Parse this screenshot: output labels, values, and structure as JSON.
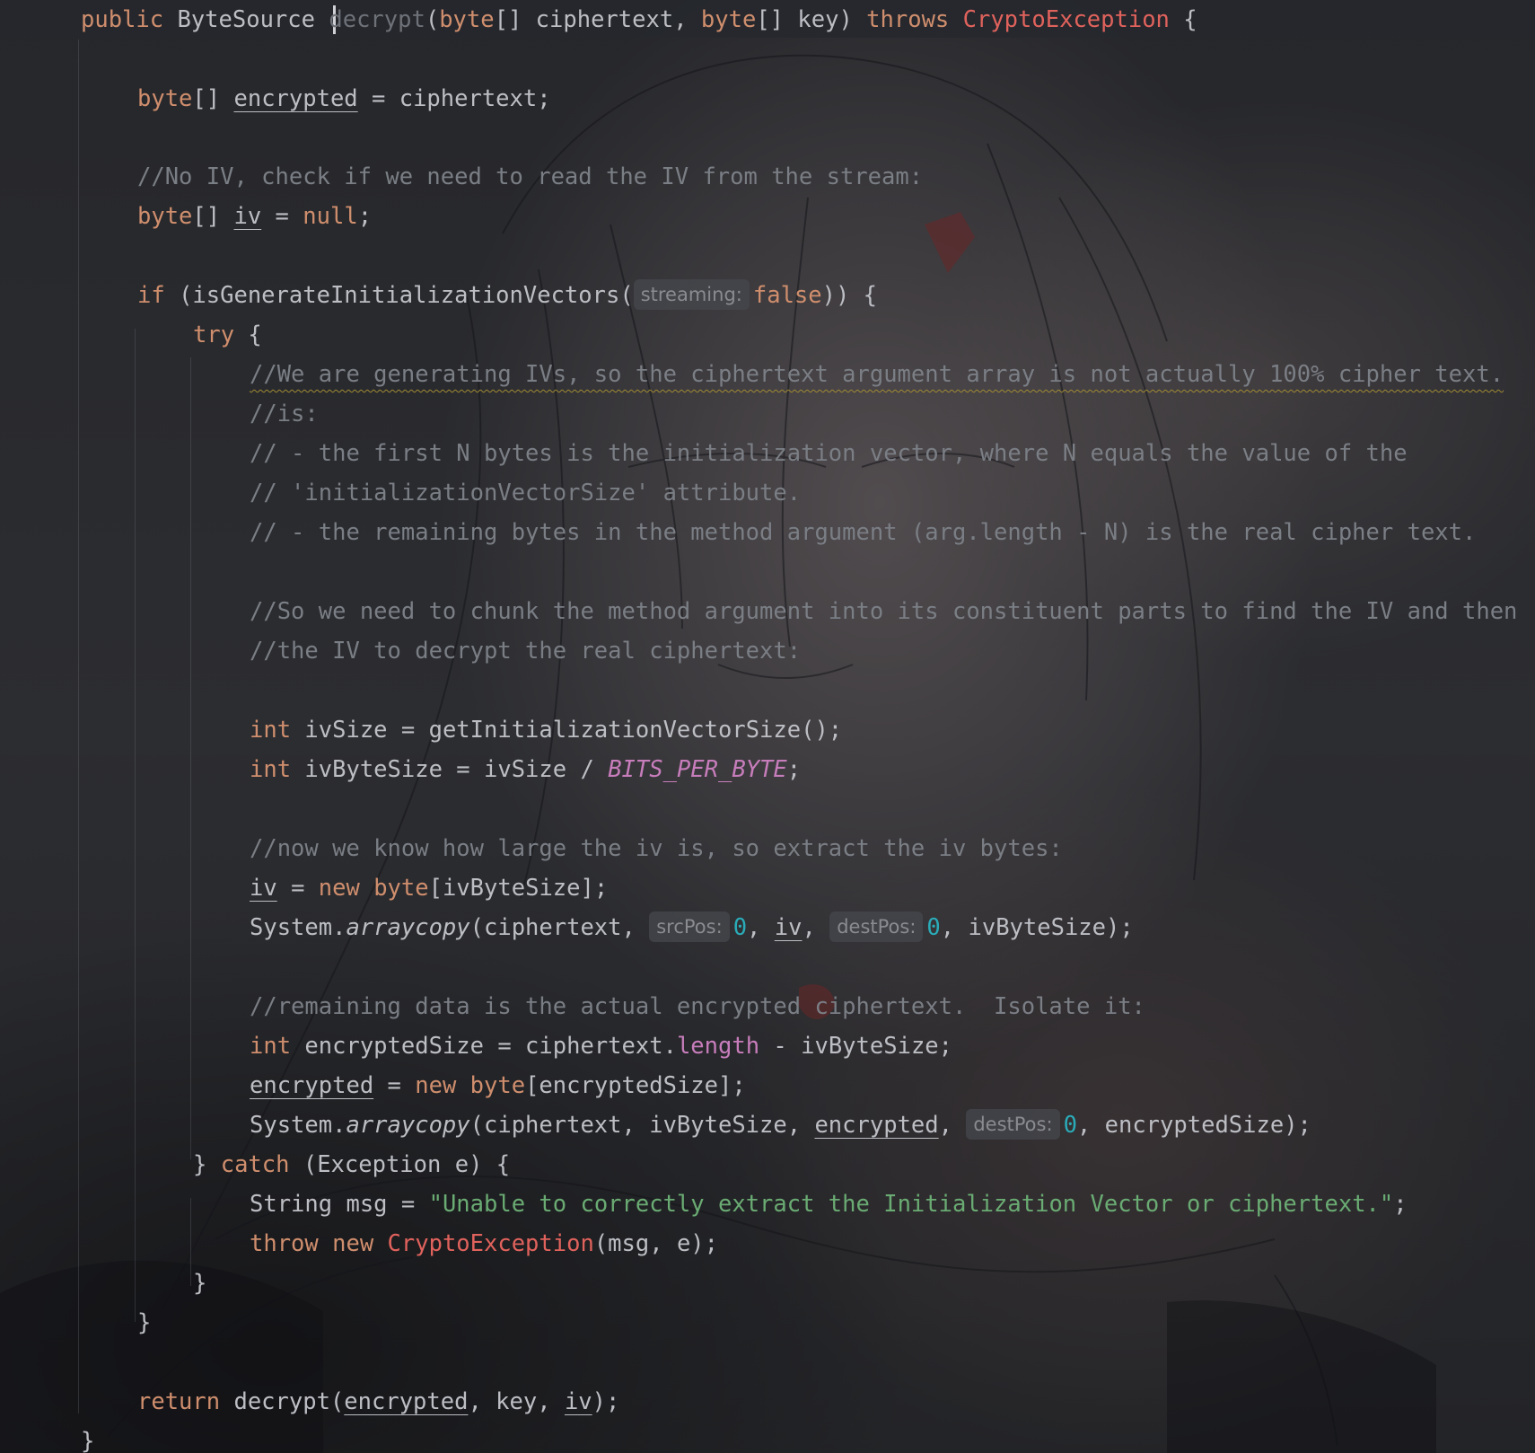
{
  "l1": {
    "a": "public ",
    "b": "ByteSource ",
    "c": "decrypt",
    "d": "(",
    "e": "byte",
    "f": "[] ciphertext, ",
    "g": "byte",
    "h": "[] key) ",
    "i": "throws ",
    "j": "CryptoException",
    "k": " {"
  },
  "l2": {
    "a": "byte",
    "b": "[] ",
    "c": "encrypted",
    "d": " = ciphertext;"
  },
  "l3": {
    "a": "//No IV, check if we need to read the IV from the stream:"
  },
  "l4": {
    "a": "byte",
    "b": "[] ",
    "c": "iv",
    "d": " = ",
    "e": "null",
    "f": ";"
  },
  "l5": {
    "a": "if ",
    "b": "(isGenerateInitializationVectors(",
    "hint": "streaming:",
    "c": "false",
    "d": ")) {"
  },
  "l6": {
    "a": "try",
    "b": " {"
  },
  "l7": {
    "a": "//We are generating IVs, so the ciphertext argument array is not actually 100% cipher text."
  },
  "l8": {
    "a": "//is:"
  },
  "l9": {
    "a": "// - the first N bytes is the initialization vector, where N equals the value of the"
  },
  "l10": {
    "a": "// 'initializationVectorSize' attribute."
  },
  "l11": {
    "a": "// - the remaining bytes in the method argument (arg.length - N) is the real cipher text."
  },
  "l12": {
    "a": "//So we need to chunk the method argument into its constituent parts to find the IV and then"
  },
  "l13": {
    "a": "//the IV to decrypt the real ciphertext:"
  },
  "l14": {
    "a": "int ",
    "b": "ivSize = getInitializationVectorSize();"
  },
  "l15": {
    "a": "int ",
    "b": "ivByteSize = ivSize / ",
    "c": "BITS_PER_BYTE",
    "d": ";"
  },
  "l16": {
    "a": "//now we know how large the iv is, so extract the iv bytes:"
  },
  "l17": {
    "a": "iv",
    "b": " = ",
    "c": "new ",
    "d": "byte",
    "e": "[ivByteSize];"
  },
  "l18": {
    "a": "System.",
    "b": "arraycopy",
    "c": "(ciphertext, ",
    "hint1": "srcPos:",
    "d": "0",
    "e": ", ",
    "f": "iv",
    "g": ", ",
    "hint2": "destPos:",
    "h": "0",
    "i": ", ivByteSize);"
  },
  "l19": {
    "a": "//remaining data is the actual encrypted ciphertext.  Isolate it:"
  },
  "l20": {
    "a": "int ",
    "b": "encryptedSize = ciphertext.",
    "c": "length",
    "d": " - ivByteSize;"
  },
  "l21": {
    "a": "encrypted",
    "b": " = ",
    "c": "new ",
    "d": "byte",
    "e": "[encryptedSize];"
  },
  "l22": {
    "a": "System.",
    "b": "arraycopy",
    "c": "(ciphertext, ivByteSize, ",
    "d": "encrypted",
    "e": ", ",
    "hint": "destPos:",
    "f": "0",
    "g": ", encryptedSize);"
  },
  "l23": {
    "a": "} ",
    "b": "catch ",
    "c": "(Exception e) {"
  },
  "l24": {
    "a": "String msg = ",
    "b": "\"Unable to correctly extract the Initialization Vector or ciphertext.\"",
    "c": ";"
  },
  "l25": {
    "a": "throw new ",
    "b": "CryptoException",
    "c": "(msg, e);"
  },
  "l26": {
    "a": "}"
  },
  "l27": {
    "a": "}"
  },
  "l28": {
    "a": "return ",
    "b": "decrypt(",
    "c": "encrypted",
    "d": ", key, ",
    "e": "iv",
    "f": ");"
  },
  "l29": {
    "a": "}"
  },
  "theme": {
    "background": "#1e1f22",
    "keyword": "#cf8e6d",
    "class_error": "#e0625c",
    "comment": "#7a7e85",
    "string": "#6aab73",
    "number": "#2aacb8",
    "constant": "#c77dbb",
    "text": "#bcbec4"
  }
}
